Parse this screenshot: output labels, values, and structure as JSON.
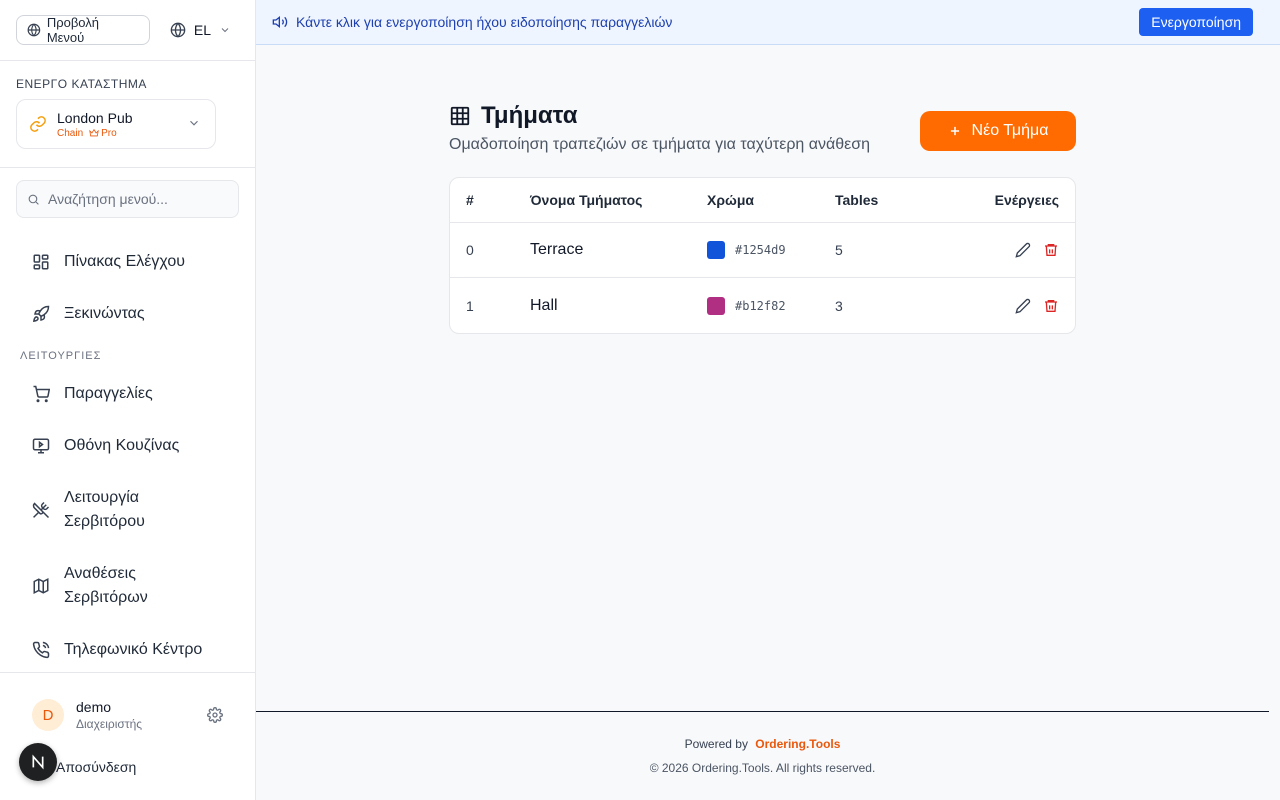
{
  "sidebar": {
    "menu_view_label": "Προβολή Μενού",
    "language": "EL",
    "store_heading": "ΕΝΕΡΓΟ ΚΑΤΑΣΤΗΜΑ",
    "store_name": "London Pub",
    "store_tag_chain": "Chain",
    "store_tag_pro": "Pro",
    "search_placeholder": "Αναζήτηση μενού...",
    "nav_top": [
      {
        "label": "Πίνακας Ελέγχου",
        "icon": "dashboard-icon"
      },
      {
        "label": "Ξεκινώντας",
        "icon": "rocket-icon"
      }
    ],
    "section_label": "ΛΕΙΤΟΥΡΓΙΕΣ",
    "nav_ops": [
      {
        "label": "Παραγγελίες",
        "icon": "cart-icon"
      },
      {
        "label": "Οθόνη Κουζίνας",
        "icon": "monitor-icon"
      },
      {
        "label_line1": "Λειτουργία",
        "label_line2": "Σερβιτόρου",
        "icon": "utensils-crossed-icon"
      },
      {
        "label_line1": "Αναθέσεις",
        "label_line2": "Σερβιτόρων",
        "icon": "map-icon"
      },
      {
        "label": "Τηλεφωνικό Κέντρο",
        "icon": "phone-icon"
      }
    ],
    "user": {
      "initial": "D",
      "name": "demo",
      "role": "Διαχειριστής"
    },
    "logout_label": "Αποσύνδεση",
    "badge_letter": "N"
  },
  "banner": {
    "text": "Κάντε κλικ για ενεργοποίηση ήχου ειδοποίησης παραγγελιών",
    "button_label": "Ενεργοποίηση"
  },
  "page": {
    "title": "Τμήματα",
    "subtitle": "Ομαδοποίηση τραπεζιών σε τμήματα για ταχύτερη ανάθεση",
    "new_button_label": "Νέο Τμήμα"
  },
  "table": {
    "headers": {
      "num": "#",
      "name": "Όνομα Τμήματος",
      "color": "Χρώμα",
      "tables": "Tables",
      "actions": "Ενέργειες"
    },
    "rows": [
      {
        "num": "0",
        "name": "Terrace",
        "color": "#1254d9",
        "tables": "5"
      },
      {
        "num": "1",
        "name": "Hall",
        "color": "#b12f82",
        "tables": "3"
      }
    ]
  },
  "footer": {
    "powered_by": "Powered by",
    "brand": "Ordering.Tools",
    "copyright": "© 2026 Ordering.Tools. All rights reserved."
  },
  "colors": {
    "accent": "#ff6b00",
    "primary_blue": "#1d5ff0",
    "danger": "#dc2626"
  }
}
